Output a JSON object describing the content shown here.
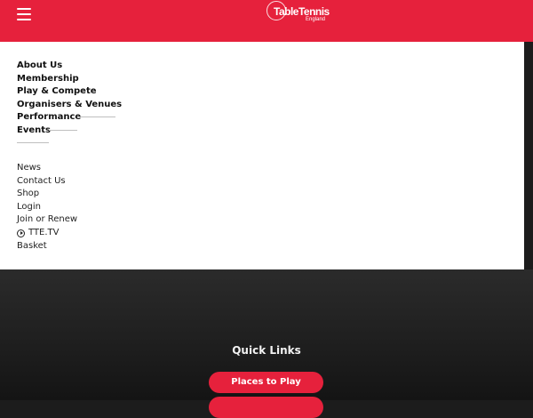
{
  "header": {
    "menu_icon": "hamburger-icon",
    "logo_text": "TableTennis",
    "logo_subtext": "England",
    "background_color": "#e6213c"
  },
  "primary_nav": [
    {
      "label": "About Us"
    },
    {
      "label": "Membership"
    },
    {
      "label": "Play & Compete"
    },
    {
      "label": "Organisers & Venues"
    },
    {
      "label": "Performance"
    },
    {
      "label": "Events"
    }
  ],
  "secondary_nav": [
    {
      "label": "News"
    },
    {
      "label": "Contact Us"
    },
    {
      "label": "Shop"
    },
    {
      "label": "Login"
    },
    {
      "label": "Join or Renew"
    },
    {
      "label": "TTE.TV",
      "icon": "play-circle-icon"
    },
    {
      "label": "Basket"
    }
  ],
  "quick_links": {
    "title": "Quick Links",
    "buttons": [
      {
        "label": "Places to Play"
      },
      {
        "label": ""
      }
    ]
  }
}
